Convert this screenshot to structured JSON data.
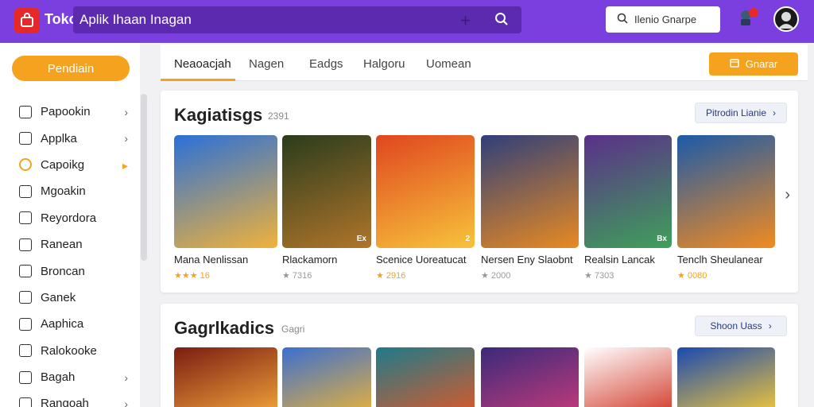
{
  "app": {
    "brand": "Toko",
    "search_value": "Aplik  Ihaan  Inagan",
    "top_button": "Ilenio  Gnarpe"
  },
  "sidebar": {
    "primary_button": "Pendiain",
    "items": [
      {
        "label": "Papookin",
        "icon": "check-square-icon",
        "chevron": true
      },
      {
        "label": "Applka",
        "icon": "send-icon",
        "chevron": true
      },
      {
        "label": "Capoikg",
        "icon": "circle-icon",
        "chevron": true,
        "active": true
      },
      {
        "label": "Mgoakin",
        "icon": "dashboard-icon",
        "chevron": false
      },
      {
        "label": "Reyordora",
        "icon": "list-icon",
        "chevron": false
      },
      {
        "label": "Ranean",
        "icon": "copy-icon",
        "chevron": false
      },
      {
        "label": "Broncan",
        "icon": "box-icon",
        "chevron": false
      },
      {
        "label": "Ganek",
        "icon": "gamepad-icon",
        "chevron": false
      },
      {
        "label": "Aaphica",
        "icon": "document-icon",
        "chevron": false
      },
      {
        "label": "Ralokooke",
        "icon": "tag-icon",
        "chevron": false
      },
      {
        "label": "Bagah",
        "icon": "square-icon",
        "chevron": true
      },
      {
        "label": "Rangoah",
        "icon": "window-icon",
        "chevron": true
      }
    ]
  },
  "tabs": {
    "items": [
      "Neaoacjah",
      "Nagen",
      "Eadgs",
      "Halgoru",
      "Uomean"
    ],
    "action_label": "Gnarar"
  },
  "sections": [
    {
      "title": "Kagiatisgs",
      "count": "2391",
      "see_all": "Pitrodin  Lianie",
      "cards": [
        {
          "name": "Mana  Nenlissan",
          "rating": "★★★ 16",
          "stars_color": "#f5a21f",
          "badge": "",
          "art": [
            "#2a70d8",
            "#f0b23a"
          ]
        },
        {
          "name": "Rlackamorn",
          "rating": "★  7316",
          "stars_color": "#999999",
          "badge": "Ex",
          "art": [
            "#2a3c1c",
            "#b0752a"
          ]
        },
        {
          "name": "Scenice  Uoreatucat",
          "rating": "★  2916",
          "stars_color": "#f5a21f",
          "badge": "2",
          "art": [
            "#e0461f",
            "#f7c33b"
          ]
        },
        {
          "name": "Nersen  Eny  Slaobnt",
          "rating": "★  2000",
          "stars_color": "#999999",
          "badge": "",
          "art": [
            "#2f3f7a",
            "#e88a22"
          ]
        },
        {
          "name": "Realsin  Lancak",
          "rating": "★  7303",
          "stars_color": "#999999",
          "badge": "Bx",
          "art": [
            "#5b2f8a",
            "#3fa05a"
          ]
        },
        {
          "name": "Tenclh  Sheulanear",
          "rating": "★  0080",
          "stars_color": "#f5a21f",
          "badge": "",
          "art": [
            "#1b5aa8",
            "#f28b20"
          ]
        }
      ]
    },
    {
      "title": "Gagrlkadics",
      "count": "Gagri",
      "see_all": "Shoon  Uass",
      "cards": [
        {
          "art": [
            "#7a1d12",
            "#f3a33a"
          ]
        },
        {
          "art": [
            "#3b6fd0",
            "#e8b23a"
          ]
        },
        {
          "art": [
            "#1f7a8a",
            "#d95a2a"
          ]
        },
        {
          "art": [
            "#3a2a7a",
            "#c43a7a"
          ]
        },
        {
          "art": [
            "#ffffff",
            "#d23a2a"
          ]
        },
        {
          "art": [
            "#1a4ab0",
            "#f5c838"
          ]
        }
      ]
    }
  ],
  "colors": {
    "topbar": "#7b3fe0",
    "accent": "#f5a21f",
    "danger": "#e62828"
  }
}
